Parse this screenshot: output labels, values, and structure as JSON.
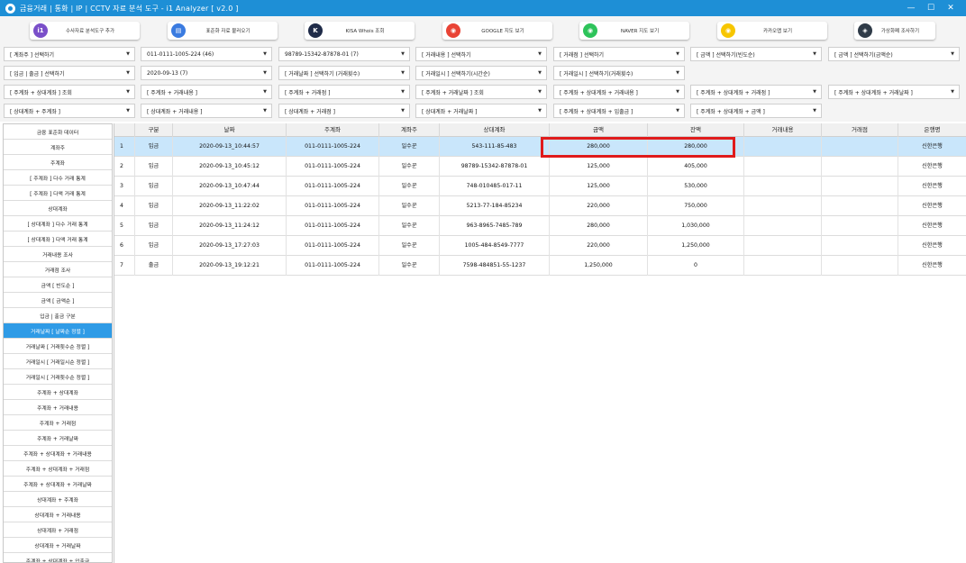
{
  "window": {
    "title": "금융거래 | 통화 | IP | CCTV 자료 분석 도구 - i1 Analyzer [ v2.0 ]",
    "controls": [
      "—",
      "☐",
      "✕"
    ]
  },
  "toolbar": [
    {
      "label": "수사자료 분석도구 추가",
      "icon": "plus-circle-icon",
      "color": "#7a4fc9",
      "glyph": "i1"
    },
    {
      "label": "표준화 자료 불러오기",
      "icon": "document-icon",
      "color": "#3a7be0",
      "glyph": "▤"
    },
    {
      "label": "KISA Whois 조회",
      "icon": "kisa-logo-icon",
      "color": "#1f2b48",
      "glyph": "K"
    },
    {
      "label": "GOOGLE 지도 보기",
      "icon": "google-maps-icon",
      "color": "#e94335",
      "glyph": "◉"
    },
    {
      "label": "NAVER 지도 보기",
      "icon": "naver-map-icon",
      "color": "#2dc35a",
      "glyph": "◉"
    },
    {
      "label": "카카오맵 보기",
      "icon": "kakao-map-icon",
      "color": "#f7c600",
      "glyph": "◉"
    },
    {
      "label": "가상화폐 조사하기",
      "icon": "crypto-icon",
      "color": "#2f3b48",
      "glyph": "◈"
    }
  ],
  "filters": {
    "row1": [
      "[ 계좌주 ] 선택하기",
      "011-0111-1005-224 (46)",
      "98789-15342-87878-01 (7)",
      "[ 거래내용 ] 선택하기",
      "[ 거래점 ] 선택하기",
      "[ 금액 ] 선택하기(빈도순)",
      "[ 금액 ] 선택하기(금액순)"
    ],
    "row2": [
      "[ 입금 | 출금 ] 선택하기",
      "2020-09-13 (7)",
      "[ 거래날짜 ] 선택하기 (거래횟수)",
      "[ 거래일시 ] 선택하기(시간순)",
      "[ 거래일시 ] 선택하기(거래횟수)"
    ],
    "row3": [
      "[ 주계좌 + 상대계좌 ] 조회",
      "[ 주계좌 + 거래내용 ]",
      "[ 주계좌 + 거래점 ]",
      "[ 주계좌 + 거래날짜 ] 조회",
      "[ 주계좌 + 상대계좌 + 거래내용 ]",
      "[ 주계좌 + 상대계좌 + 거래점 ]",
      "[ 주계좌 + 상대계좌 + 거래날짜 ]"
    ],
    "row4": [
      "[ 상대계좌 + 주계좌 ]",
      "[ 상대계좌 + 거래내용 ]",
      "[ 상대계좌 + 거래점 ]",
      "[ 상대계좌 + 거래날짜 ]",
      "[ 주계좌 + 상대계좌 + 입출금 ]",
      "[ 주계좌 + 상대계좌 + 금액 ]"
    ]
  },
  "sidebar": {
    "items": [
      "금융 표준화 데이터",
      "계좌주",
      "주계좌",
      "[ 주계좌 ] 다수 거래 통계",
      "[ 주계좌 ] 다액 거래 통계",
      "상대계좌",
      "[ 상대계좌 ] 다수 거래 통계",
      "[ 상대계좌 ] 다액 거래 통계",
      "거래내용 조사",
      "거래점 조사",
      "금액 [ 빈도순 ]",
      "금액 [ 금액순 ]",
      "입금 | 출금 구분",
      "거래날짜 [ 날짜순 정렬 ]",
      "거래날짜 [ 거래횟수순 정렬 ]",
      "거래일시 [ 거래일시순 정렬 ]",
      "거래일시 [ 거래횟수순 정렬 ]",
      "주계좌 + 상대계좌",
      "주계좌 + 거래내용",
      "주계좌 + 거래점",
      "주계좌 + 거래날짜",
      "주계좌 + 상대계좌 + 거래내용",
      "주계좌 + 상대계좌 + 거래점",
      "주계좌 + 상대계좌 + 거래날짜",
      "상대계좌 + 주계좌",
      "상대계좌 + 거래내용",
      "상대계좌 + 거래점",
      "상대계좌 + 거래날짜",
      "주계좌 + 상대계좌 + 입출금"
    ],
    "selected_index": 13
  },
  "grid": {
    "columns": [
      "",
      "구분",
      "날짜",
      "주계좌",
      "계좌주",
      "상대계좌",
      "금액",
      "잔액",
      "거래내용",
      "거래점",
      "은행명"
    ],
    "rows": [
      [
        "1",
        "입금",
        "2020-09-13_10:44:57",
        "011-0111-1005-224",
        "일수꾼",
        "543-111-85-483",
        "280,000",
        "280,000",
        "",
        "",
        "신한은행"
      ],
      [
        "2",
        "입금",
        "2020-09-13_10:45:12",
        "011-0111-1005-224",
        "일수꾼",
        "98789-15342-87878-01",
        "125,000",
        "405,000",
        "",
        "",
        "신한은행"
      ],
      [
        "3",
        "입금",
        "2020-09-13_10:47:44",
        "011-0111-1005-224",
        "일수꾼",
        "748-010485-017-11",
        "125,000",
        "530,000",
        "",
        "",
        "신한은행"
      ],
      [
        "4",
        "입금",
        "2020-09-13_11:22:02",
        "011-0111-1005-224",
        "일수꾼",
        "5213-77-184-85234",
        "220,000",
        "750,000",
        "",
        "",
        "신한은행"
      ],
      [
        "5",
        "입금",
        "2020-09-13_11:24:12",
        "011-0111-1005-224",
        "일수꾼",
        "963-8965-7485-789",
        "280,000",
        "1,030,000",
        "",
        "",
        "신한은행"
      ],
      [
        "6",
        "입금",
        "2020-09-13_17:27:03",
        "011-0111-1005-224",
        "일수꾼",
        "1005-484-8549-7777",
        "220,000",
        "1,250,000",
        "",
        "",
        "신한은행"
      ],
      [
        "7",
        "출금",
        "2020-09-13_19:12:21",
        "011-0111-1005-224",
        "일수꾼",
        "7598-484851-55-1237",
        "1,250,000",
        "0",
        "",
        "",
        "신한은행"
      ]
    ],
    "selected_row": 0
  },
  "colors": {
    "titlebar": "#1e8fd6",
    "selection": "#c9e6fb",
    "sidebar_selected": "#2f9be6",
    "highlight": "#e01b1b"
  }
}
